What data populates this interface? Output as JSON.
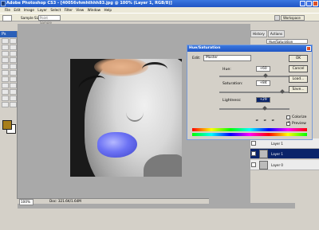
{
  "window": {
    "title": "Adobe Photoshop CS3 - [40056vhmhthhh83.jpg @ 100% (Layer 1, RGB/8)]"
  },
  "menu": [
    "File",
    "Edit",
    "Image",
    "Layer",
    "Select",
    "Filter",
    "View",
    "Window",
    "Help"
  ],
  "options": {
    "sample_label": "Sample Size:",
    "sample_value": "Point Sample",
    "workspace": "Workspace"
  },
  "toolbox": {
    "header": "Ps"
  },
  "status": {
    "zoom": "100%",
    "doc": "Doc: 321.6K/1.64M"
  },
  "panel": {
    "tabs": [
      "History",
      "Actions"
    ],
    "history_item": "Hue/Saturation"
  },
  "layers": [
    {
      "name": "Layer 1",
      "selected": false
    },
    {
      "name": "Layer 1",
      "selected": true
    },
    {
      "name": "Layer 0",
      "selected": false
    }
  ],
  "dialog": {
    "title": "Hue/Saturation",
    "edit_label": "Edit:",
    "edit_value": "Master",
    "hue_label": "Hue:",
    "hue_value": "+60",
    "saturation_label": "Saturation:",
    "saturation_value": "+84",
    "lightness_label": "Lightness:",
    "lightness_value": "+29",
    "buttons": [
      "OK",
      "Cancel",
      "Load...",
      "Save..."
    ],
    "colorize_label": "Colorize",
    "preview_label": "Preview",
    "hue_level": 0.67,
    "saturation_level": 0.92,
    "lightness_level": 0.65
  },
  "colors": {
    "accent": "#0a246a",
    "titlebar": "#2a60d0",
    "lips": "#6c72f4",
    "foreground": "#a87e1a"
  }
}
